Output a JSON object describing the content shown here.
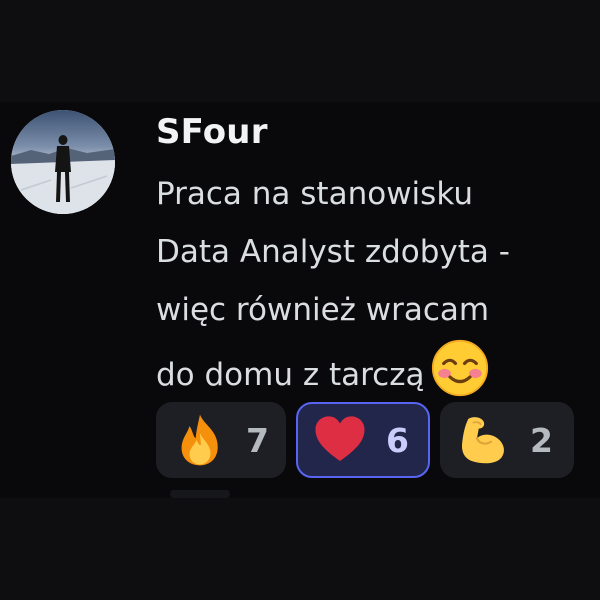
{
  "message": {
    "author": "SFour",
    "lines": [
      "Praca na stanowisku",
      "Data Analyst zdobyta -",
      "więc również wracam",
      "do domu z tarczą"
    ],
    "inline_emoji": "smiling-face-with-blush-emoji"
  },
  "reactions": [
    {
      "emoji": "fire-emoji",
      "count": "7",
      "active": false
    },
    {
      "emoji": "red-heart-emoji",
      "count": "6",
      "active": true
    },
    {
      "emoji": "flexed-biceps-emoji",
      "count": "2",
      "active": false
    }
  ],
  "colors": {
    "background": "#09090b",
    "username": "#f2f3f5",
    "message_text": "#dbdee1",
    "reaction_bg": "#1e1f24",
    "reaction_active_bg": "#22264b",
    "reaction_active_border": "#5865f2"
  }
}
